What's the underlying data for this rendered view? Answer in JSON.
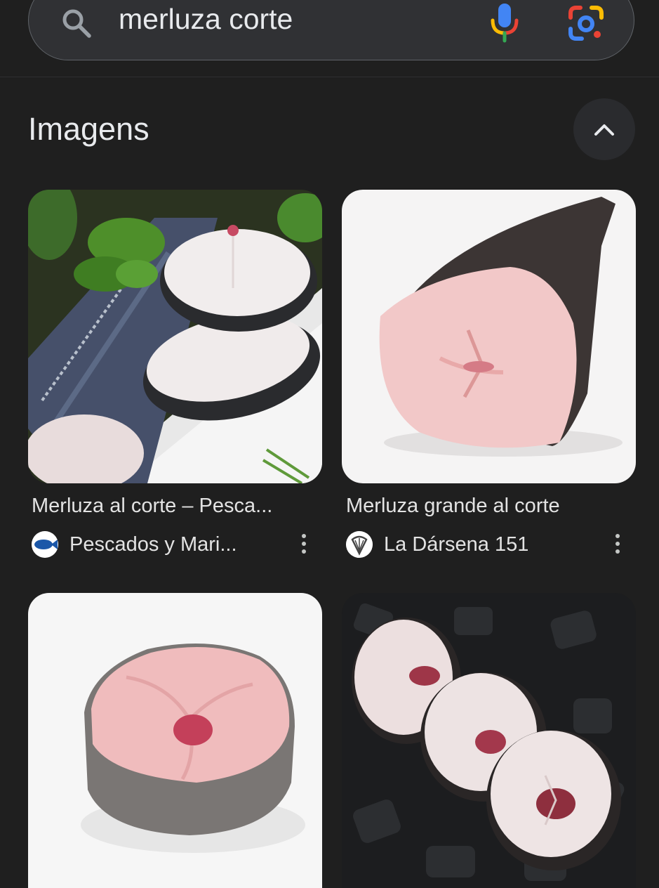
{
  "search": {
    "query": "merluza corte"
  },
  "section": {
    "title": "Imagens"
  },
  "results": [
    {
      "title": "Merluza al corte – Pesca...",
      "source": "Pescados y Mari..."
    },
    {
      "title": "Merluza grande al corte",
      "source": "La Dársena 151"
    }
  ],
  "icons": {
    "search": "search-icon",
    "voice": "mic-icon",
    "lens": "lens-icon",
    "collapse": "chevron-up-icon",
    "more": "more-vert-icon"
  },
  "colors": {
    "background": "#1f1f1f",
    "searchbar": "#303134",
    "text": "#e3e3e3",
    "google_blue": "#4285f4",
    "google_red": "#ea4335",
    "google_yellow": "#fbbc04",
    "google_green": "#34a853"
  }
}
